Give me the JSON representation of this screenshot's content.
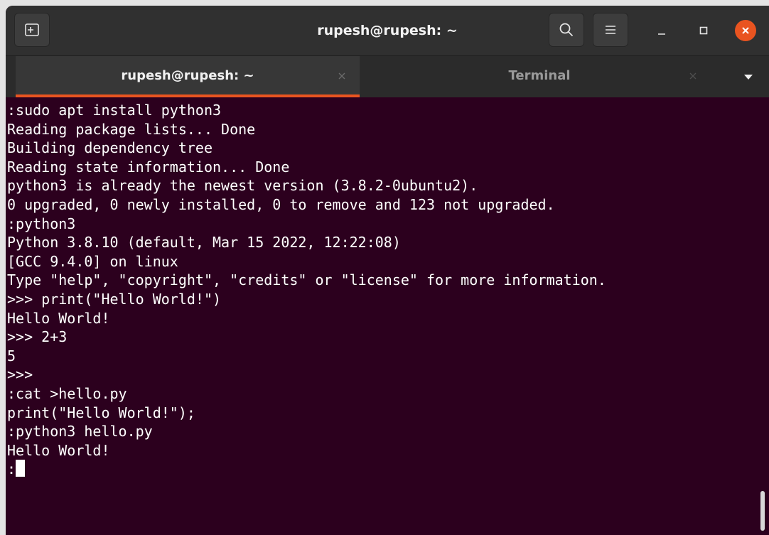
{
  "window": {
    "title": "rupesh@rupesh: ~"
  },
  "tabs": [
    {
      "label": "rupesh@rupesh: ~",
      "active": true
    },
    {
      "label": "Terminal",
      "active": false
    }
  ],
  "icons": {
    "new_tab": "new-tab-icon",
    "search": "search-icon",
    "menu": "hamburger-menu-icon",
    "minimize": "minimize-icon",
    "maximize": "maximize-icon",
    "close": "close-icon",
    "tab_close": "close-icon",
    "dropdown": "chevron-down-icon"
  },
  "colors": {
    "terminal_bg": "#2c001e",
    "accent": "#e95420",
    "text": "#ffffff"
  },
  "terminal": {
    "lines": [
      ":sudo apt install python3",
      "Reading package lists... Done",
      "Building dependency tree",
      "Reading state information... Done",
      "python3 is already the newest version (3.8.2-0ubuntu2).",
      "0 upgraded, 0 newly installed, 0 to remove and 123 not upgraded.",
      ":python3",
      "Python 3.8.10 (default, Mar 15 2022, 12:22:08)",
      "[GCC 9.4.0] on linux",
      "Type \"help\", \"copyright\", \"credits\" or \"license\" for more information.",
      ">>> print(\"Hello World!\")",
      "Hello World!",
      ">>> 2+3",
      "5",
      ">>>",
      ":cat >hello.py",
      "print(\"Hello World!\");",
      ":python3 hello.py",
      "Hello World!"
    ],
    "prompt": ":"
  }
}
